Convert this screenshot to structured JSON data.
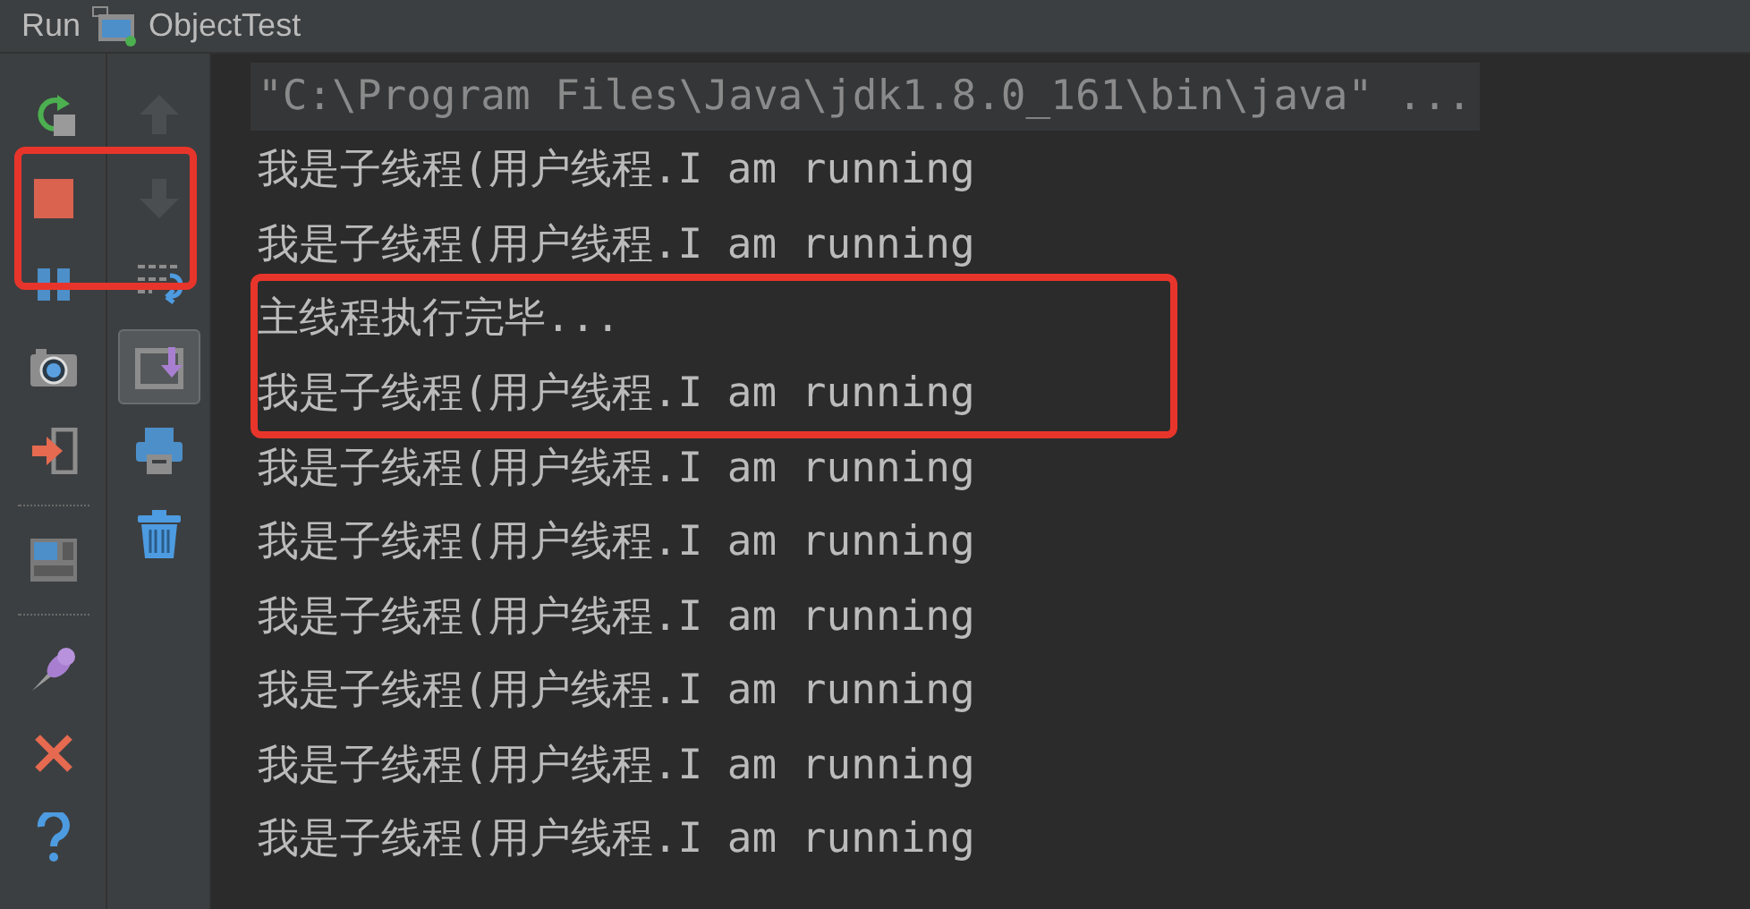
{
  "panel": {
    "title": "Run",
    "tab": "ObjectTest"
  },
  "toolbar_left": [
    {
      "kind": "rerun"
    },
    {
      "kind": "stop"
    },
    {
      "kind": "pause"
    },
    {
      "kind": "camera"
    },
    {
      "kind": "exit"
    },
    {
      "kind": "divider"
    },
    {
      "kind": "layout"
    },
    {
      "kind": "divider"
    },
    {
      "kind": "pin"
    },
    {
      "kind": "close"
    },
    {
      "kind": "help"
    }
  ],
  "toolbar_right": [
    {
      "kind": "up",
      "disabled": true,
      "pressed": false
    },
    {
      "kind": "down",
      "disabled": true,
      "pressed": false
    },
    {
      "kind": "wrap",
      "disabled": false,
      "pressed": false
    },
    {
      "kind": "scroll-end",
      "disabled": false,
      "pressed": true
    },
    {
      "kind": "print",
      "disabled": false,
      "pressed": false
    },
    {
      "kind": "trash",
      "disabled": false,
      "pressed": false
    }
  ],
  "console": [
    {
      "kind": "command",
      "text": "\"C:\\Program Files\\Java\\jdk1.8.0_161\\bin\\java\" ..."
    },
    {
      "kind": "output",
      "text": "我是子线程(用户线程.I am running"
    },
    {
      "kind": "output",
      "text": "我是子线程(用户线程.I am running"
    },
    {
      "kind": "output",
      "text": "主线程执行完毕..."
    },
    {
      "kind": "output",
      "text": "我是子线程(用户线程.I am running"
    },
    {
      "kind": "output",
      "text": "我是子线程(用户线程.I am running"
    },
    {
      "kind": "output",
      "text": "我是子线程(用户线程.I am running"
    },
    {
      "kind": "output",
      "text": "我是子线程(用户线程.I am running"
    },
    {
      "kind": "output",
      "text": "我是子线程(用户线程.I am running"
    },
    {
      "kind": "output",
      "text": "我是子线程(用户线程.I am running"
    },
    {
      "kind": "output",
      "text": "我是子线程(用户线程.I am running"
    }
  ]
}
